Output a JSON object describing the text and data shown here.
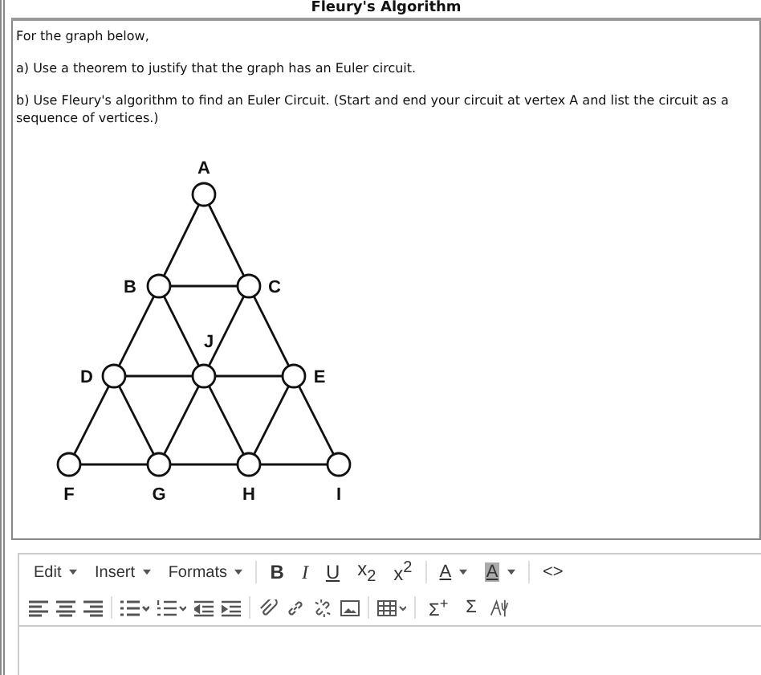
{
  "window": {
    "title": "Fleury's Algorithm"
  },
  "question": {
    "paragraphs": [
      "For the graph below,",
      "a) Use a theorem to justify that the graph has an Euler circuit.",
      "b) Use Fleury's algorithm to find an Euler Circuit. (Start and end your circuit at vertex A and list the circuit as a sequence of vertices.)"
    ]
  },
  "graph": {
    "vertices": [
      "A",
      "B",
      "C",
      "D",
      "J",
      "E",
      "F",
      "G",
      "H",
      "I"
    ]
  },
  "editor": {
    "menus": [
      "Edit",
      "Insert",
      "Formats"
    ],
    "format_buttons": [
      {
        "kind": "bold",
        "label": "B"
      },
      {
        "kind": "italic",
        "label": "I"
      },
      {
        "kind": "underline",
        "label": "U"
      },
      {
        "kind": "script",
        "label": "x$_{2}$"
      },
      {
        "kind": "script",
        "label": "x$^{2}$"
      }
    ],
    "color_buttons": [
      {
        "kind": "text",
        "label": "A"
      },
      {
        "kind": "background",
        "label": "A"
      }
    ],
    "code_button": "<>",
    "math_buttons": [
      "Σ$^{+}$",
      "Σ"
    ]
  }
}
